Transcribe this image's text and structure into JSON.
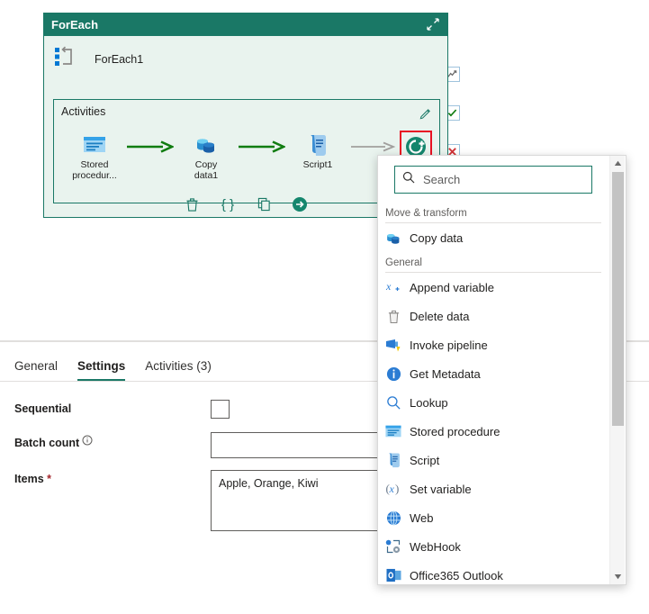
{
  "panel": {
    "header_title": "ForEach",
    "collapse_icon": "collapse-diagonal-icon",
    "node_name": "ForEach1",
    "node_icon": "foreach-loop-icon",
    "activities_label": "Activities",
    "edit_icon": "pencil-edit-icon"
  },
  "pipeline": {
    "nodes": [
      {
        "label": "Stored\nprocedur...",
        "icon": "stored-procedure-icon"
      },
      {
        "label": "Copy\ndata1",
        "icon": "copy-data-icon"
      },
      {
        "label": "Script1",
        "icon": "script-icon"
      }
    ],
    "node_labels": {
      "stored_procedure": "Stored procedur...",
      "stored_procedure_line1": "Stored",
      "stored_procedure_line2": "procedur...",
      "copy_data_line1": "Copy",
      "copy_data_line2": "data1",
      "script": "Script1"
    },
    "add_button_icon": "add-activity-icon",
    "arrow_colors": {
      "active": "#107c10",
      "inactive": "#a19f9d"
    }
  },
  "toolbar": {
    "buttons": [
      {
        "icon": "delete-trash-icon",
        "name": "delete"
      },
      {
        "icon": "code-braces-icon",
        "name": "code"
      },
      {
        "icon": "copy-duplicate-icon",
        "name": "duplicate"
      },
      {
        "icon": "run-arrow-icon",
        "name": "run"
      }
    ]
  },
  "side_icons": [
    {
      "icon": "chart-line-icon",
      "name": "monitor"
    },
    {
      "icon": "check-success-icon",
      "name": "success",
      "color": "#107c10"
    },
    {
      "icon": "x-failure-icon",
      "name": "failure",
      "color": "#d13438"
    }
  ],
  "tabs": [
    {
      "label": "General",
      "active": false
    },
    {
      "label": "Settings",
      "active": true
    },
    {
      "label": "Activities (3)",
      "active": false
    }
  ],
  "settings": {
    "sequential": {
      "label": "Sequential",
      "checked": false
    },
    "batch_count": {
      "label": "Batch count",
      "value": "",
      "placeholder": "",
      "info_icon": "info-circle-icon"
    },
    "items": {
      "label": "Items",
      "required_marker": "*",
      "value": "Apple, Orange, Kiwi"
    }
  },
  "flyout": {
    "search": {
      "placeholder": "Search",
      "value": "",
      "icon": "search-magnifier-icon"
    },
    "groups": [
      {
        "title": "Move & transform",
        "items": [
          {
            "label": "Copy data",
            "icon": "copy-data-icon"
          }
        ]
      },
      {
        "title": "General",
        "items": [
          {
            "label": "Append variable",
            "icon": "append-variable-icon"
          },
          {
            "label": "Delete data",
            "icon": "delete-trash-icon"
          },
          {
            "label": "Invoke pipeline",
            "icon": "invoke-pipeline-icon"
          },
          {
            "label": "Get Metadata",
            "icon": "get-metadata-icon"
          },
          {
            "label": "Lookup",
            "icon": "lookup-magnifier-icon"
          },
          {
            "label": "Stored procedure",
            "icon": "stored-procedure-icon"
          },
          {
            "label": "Script",
            "icon": "script-icon"
          },
          {
            "label": "Set variable",
            "icon": "set-variable-icon"
          },
          {
            "label": "Web",
            "icon": "web-globe-icon"
          },
          {
            "label": "WebHook",
            "icon": "webhook-icon"
          },
          {
            "label": "Office365 Outlook",
            "icon": "office365-outlook-icon"
          }
        ]
      }
    ],
    "scrollbar": {
      "up_icon": "scroll-up-arrow-icon",
      "down_icon": "scroll-down-arrow-icon"
    }
  },
  "colors": {
    "header_teal": "#1a7866",
    "panel_bg": "#e9f3ee",
    "highlight_red": "#e81123",
    "accent_blue": "#0078d4"
  }
}
